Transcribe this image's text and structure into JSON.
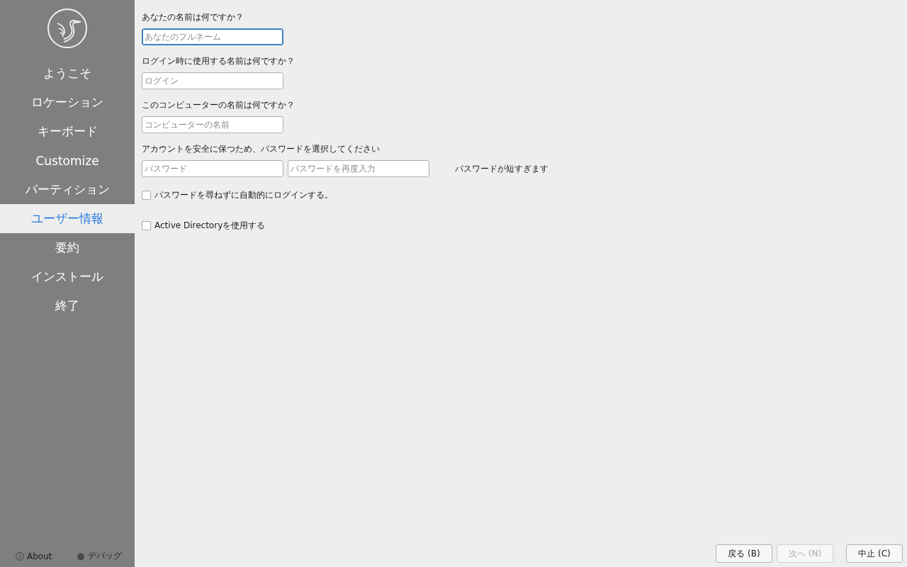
{
  "sidebar": {
    "items": [
      {
        "label": "ようこそ",
        "selected": false
      },
      {
        "label": "ロケーション",
        "selected": false
      },
      {
        "label": "キーボード",
        "selected": false
      },
      {
        "label": "Customize",
        "selected": false
      },
      {
        "label": "パーティション",
        "selected": false
      },
      {
        "label": "ユーザー情報",
        "selected": true
      },
      {
        "label": "要約",
        "selected": false
      },
      {
        "label": "インストール",
        "selected": false
      },
      {
        "label": "終了",
        "selected": false
      }
    ],
    "footer": [
      {
        "kind": "about",
        "label": "About"
      },
      {
        "kind": "debug",
        "label": "デバッグ"
      }
    ]
  },
  "form": {
    "sections": [
      {
        "label": "あなたの名前は何ですか？",
        "fields": [
          {
            "placeholder": "あなたのフルネーム",
            "focused": true
          }
        ]
      },
      {
        "label": "ログイン時に使用する名前は何ですか？",
        "fields": [
          {
            "placeholder": "ログイン",
            "focused": false
          }
        ]
      },
      {
        "label": "このコンピューターの名前は何ですか？",
        "fields": [
          {
            "placeholder": "コンピューターの名前",
            "focused": false
          }
        ]
      },
      {
        "label": "アカウントを安全に保つため、パスワードを選択してください",
        "fields": [
          {
            "placeholder": "パスワード",
            "focused": false
          },
          {
            "placeholder": "パスワードを再度入力",
            "focused": false
          }
        ],
        "message": "パスワードが短すぎます"
      }
    ],
    "checkboxes": [
      {
        "label": "パスワードを尋ねずに自動的にログインする。",
        "checked": false
      },
      {
        "label": "Active Directoryを使用する",
        "checked": false
      }
    ]
  },
  "buttons": [
    {
      "label": "戻る (B)",
      "disabled": false
    },
    {
      "label": "次へ (N)",
      "disabled": true
    },
    {
      "label": "中止 (C)",
      "disabled": false
    }
  ]
}
